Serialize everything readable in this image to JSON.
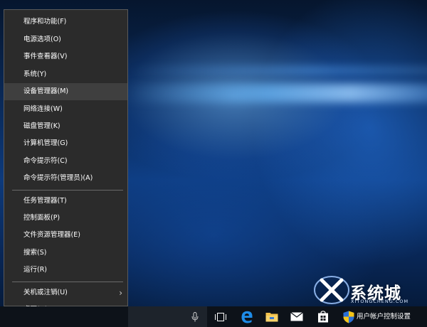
{
  "menu": {
    "items": [
      {
        "label": "程序和功能(F)"
      },
      {
        "label": "电源选项(O)"
      },
      {
        "label": "事件查看器(V)"
      },
      {
        "label": "系统(Y)"
      },
      {
        "label": "设备管理器(M)"
      },
      {
        "label": "网络连接(W)"
      },
      {
        "label": "磁盘管理(K)"
      },
      {
        "label": "计算机管理(G)"
      },
      {
        "label": "命令提示符(C)"
      },
      {
        "label": "命令提示符(管理员)(A)"
      },
      {
        "label": "任务管理器(T)"
      },
      {
        "label": "控制面板(P)"
      },
      {
        "label": "文件资源管理器(E)"
      },
      {
        "label": "搜索(S)"
      },
      {
        "label": "运行(R)"
      },
      {
        "label": "关机或注销(U)"
      },
      {
        "label": "桌面(D)"
      }
    ],
    "highlighted": "设备管理器(M)"
  },
  "taskbar": {
    "icons": [
      "microphone-icon",
      "task-view-icon",
      "edge-icon",
      "file-explorer-icon",
      "mail-icon",
      "store-icon",
      "uac-shield-icon"
    ],
    "uac_label": "用户帐户控制设置"
  },
  "watermark": {
    "text": "系统城",
    "subtext": "XITONGCHENG.COM"
  },
  "colors": {
    "menu_bg": "#2b2b2b",
    "menu_highlight": "#3f3f3f",
    "taskbar_bg": "#0d1219",
    "edge_blue": "#1e8ce8",
    "shield_blue": "#2a6fd6",
    "shield_yellow": "#f5c518"
  }
}
